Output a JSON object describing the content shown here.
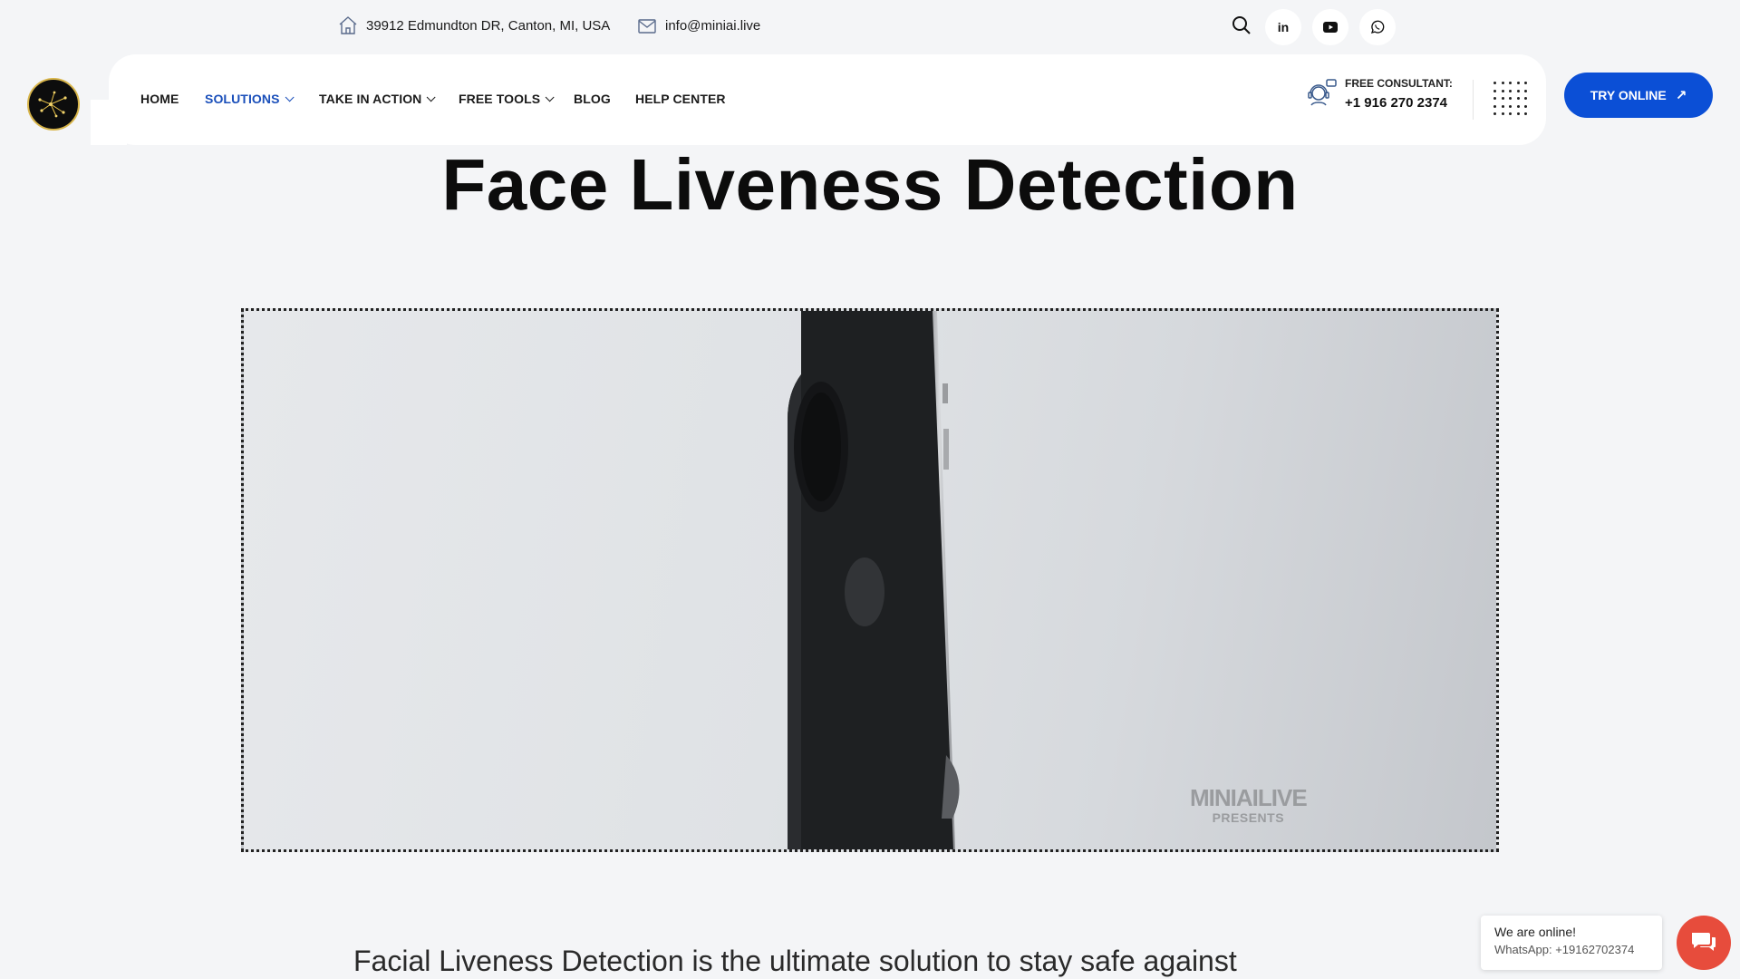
{
  "topbar": {
    "address": "39912 Edmundton DR, Canton, MI, USA",
    "email": "info@miniai.live",
    "social": [
      {
        "name": "linkedin",
        "label": "in"
      },
      {
        "name": "youtube",
        "label": "▶"
      },
      {
        "name": "whatsapp",
        "label": "✆"
      }
    ]
  },
  "nav": {
    "items": [
      {
        "label": "HOME",
        "dropdown": false,
        "active": false
      },
      {
        "label": "SOLUTIONS",
        "dropdown": true,
        "active": true
      },
      {
        "label": "TAKE IN ACTION",
        "dropdown": true,
        "active": false
      },
      {
        "label": "FREE TOOLS",
        "dropdown": true,
        "active": false
      },
      {
        "label": "BLOG",
        "dropdown": false,
        "active": false
      },
      {
        "label": "HELP CENTER",
        "dropdown": false,
        "active": false
      }
    ],
    "consult_label": "FREE CONSULTANT:",
    "consult_phone": "+1 916 270 2374",
    "cta_label": "TRY ONLINE"
  },
  "hero": {
    "title": "Face Liveness Detection",
    "video_watermark": "MINIAILIVE",
    "video_watermark_sub": "PRESENTS"
  },
  "intro_text": "Facial Liveness Detection is the ultimate solution to stay safe against",
  "chat": {
    "status": "We are online!",
    "contact": "WhatsApp: +19162702374"
  },
  "colors": {
    "accent": "#0b4fd6",
    "active_nav": "#1a4fba",
    "chat": "#e74c3c",
    "background": "#f4f5f7"
  }
}
